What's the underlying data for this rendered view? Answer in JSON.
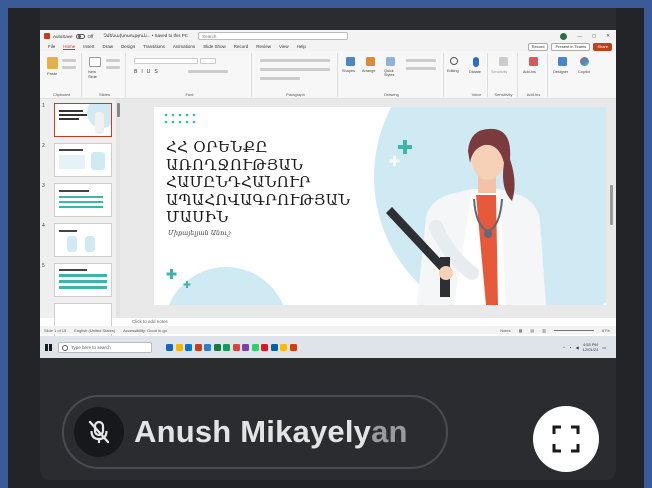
{
  "powerpoint": {
    "autosave_label": "AutoSave",
    "autosave_state": "Off",
    "file_name": "Չմենախոսություն... • Saved to this PC",
    "search_placeholder": "Search",
    "menu_tabs": [
      "File",
      "Home",
      "Insert",
      "Draw",
      "Design",
      "Transitions",
      "Animations",
      "Slide Show",
      "Record",
      "Review",
      "View",
      "Help"
    ],
    "active_tab": "Home",
    "record_label": "Record",
    "present_teams_label": "Present in Teams",
    "share_label": "Share",
    "ribbon_groups": [
      "Clipboard",
      "Slides",
      "Font",
      "Paragraph",
      "Drawing",
      "Voice",
      "Sensitivity",
      "Add-ins"
    ],
    "ribbon_buttons": {
      "paste": "Paste",
      "new_slide": "New Slide",
      "shapes": "Shapes",
      "arrange": "Arrange",
      "quick_styles": "Quick Styles",
      "editing": "Editing",
      "dictate": "Dictate",
      "sensitivity": "Sensitivity",
      "addins": "Add-ins",
      "designer": "Designer",
      "copilot": "Copilot"
    },
    "thumbnails": [
      "1",
      "2",
      "3",
      "4",
      "5"
    ],
    "slide_title_lines": [
      "ՀՀ ՕՐԵՆՔԸ",
      "ԱՌՈՂՋՈՒԹՅԱՆ",
      "ՀԱՄԸՆԴՀԱՆՈՒՐ",
      "ԱՊԱՀՈՎԱԳՐՈՒԹՅԱՆ",
      "ՄԱՍԻՆ"
    ],
    "slide_author": "Միքայելյան Անուշ",
    "notes_placeholder": "Click to add notes",
    "status_slide": "Slide 1 of 15",
    "status_language": "English (United States)",
    "status_accessibility": "Accessibility: Good to go",
    "status_notes": "Notes",
    "zoom_level": "67%"
  },
  "taskbar": {
    "search_placeholder": "Type here to search",
    "time": "4:53 PM",
    "date": "12/01/24",
    "app_colors": [
      "#1565c0",
      "#f4b400",
      "#0078d4",
      "#c43e1c",
      "#2b7cd3",
      "#107c41",
      "#0f9d58",
      "#db4437",
      "#7b3fb0",
      "#25d366",
      "#e81123",
      "#0061a8",
      "#ffb900",
      "#d83b01"
    ]
  },
  "participant": {
    "name_main": "Anush Mikayely",
    "name_fade": "an",
    "mic_state": "muted"
  },
  "colors": {
    "accent": "#c43e1c",
    "slide_teal": "#3fb5a9",
    "slide_circle": "#cfeaf3"
  }
}
